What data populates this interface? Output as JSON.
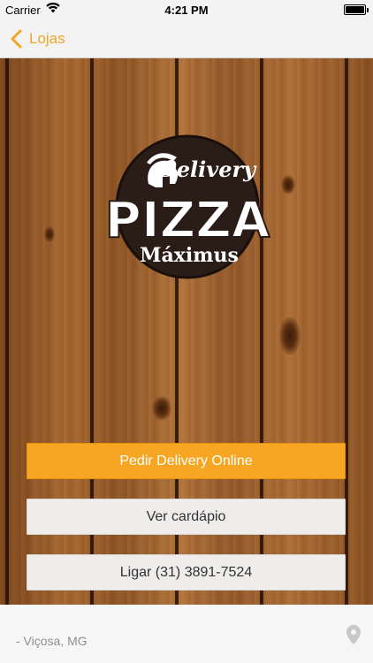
{
  "status_bar": {
    "carrier": "Carrier",
    "time": "4:21 PM",
    "wifi_icon": "wifi-icon",
    "battery_icon": "battery-icon"
  },
  "nav": {
    "back_label": "Lojas",
    "back_icon": "chevron-left-icon",
    "accent_color": "#f4a426"
  },
  "logo": {
    "line1": "Delivery",
    "line2": "PIZZA",
    "line3": "Máximus",
    "emblem_icon": "spartan-helmet-icon",
    "circle_color": "#2a1c17",
    "text_color": "#ffffff"
  },
  "actions": {
    "order_online": "Pedir Delivery Online",
    "view_menu": "Ver cardápio",
    "call": "Ligar (31) 3891-7524",
    "primary_color": "#f6a623",
    "secondary_color": "#efedeb"
  },
  "footer": {
    "location": "- Viçosa, MG",
    "map_icon": "map-pin-icon"
  }
}
